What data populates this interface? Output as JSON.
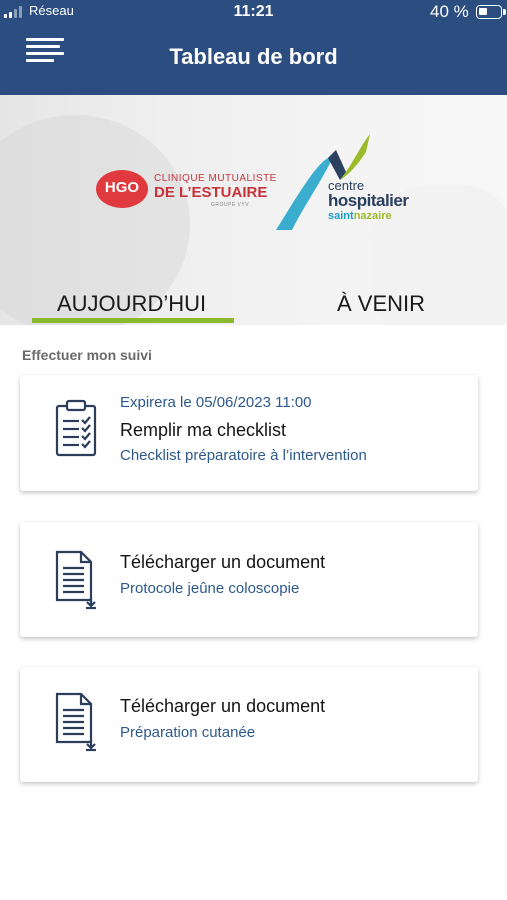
{
  "status_bar": {
    "carrier": "Réseau",
    "time": "11:21",
    "battery": "40 %",
    "battery_level": 0.4
  },
  "header": {
    "title": "Tableau de bord",
    "menu_icon": "hamburger-menu-icon"
  },
  "banner": {
    "hgo_logo": {
      "badge": "HGO",
      "line1": "CLINIQUE MUTUALISTE",
      "line2": "DE L’ESTUAIRE",
      "line3": "GROUPE VYV"
    },
    "ch_logo": {
      "line1": "centre",
      "line2": "hospitalier",
      "line3a": "saint",
      "line3b": "nazaire"
    },
    "tabs": [
      {
        "label": "AUJOURD’HUI",
        "active": true
      },
      {
        "label": "À VENIR",
        "active": false
      }
    ]
  },
  "section_title": "Effectuer mon suivi",
  "cards": [
    {
      "icon": "clipboard-checklist-icon",
      "meta": "Expirera le 05/06/2023 11:00",
      "title": "Remplir ma checklist",
      "subtitle": "Checklist préparatoire à l’intervention"
    },
    {
      "icon": "document-download-icon",
      "title": "Télécharger un document",
      "subtitle": "Protocole jeûne coloscopie"
    },
    {
      "icon": "document-download-icon",
      "title": "Télécharger un document",
      "subtitle": "Préparation cutanée"
    }
  ],
  "colors": {
    "header": "#2c4d80",
    "tab_underline": "#8ab82e",
    "link_text": "#2d5a8a"
  }
}
